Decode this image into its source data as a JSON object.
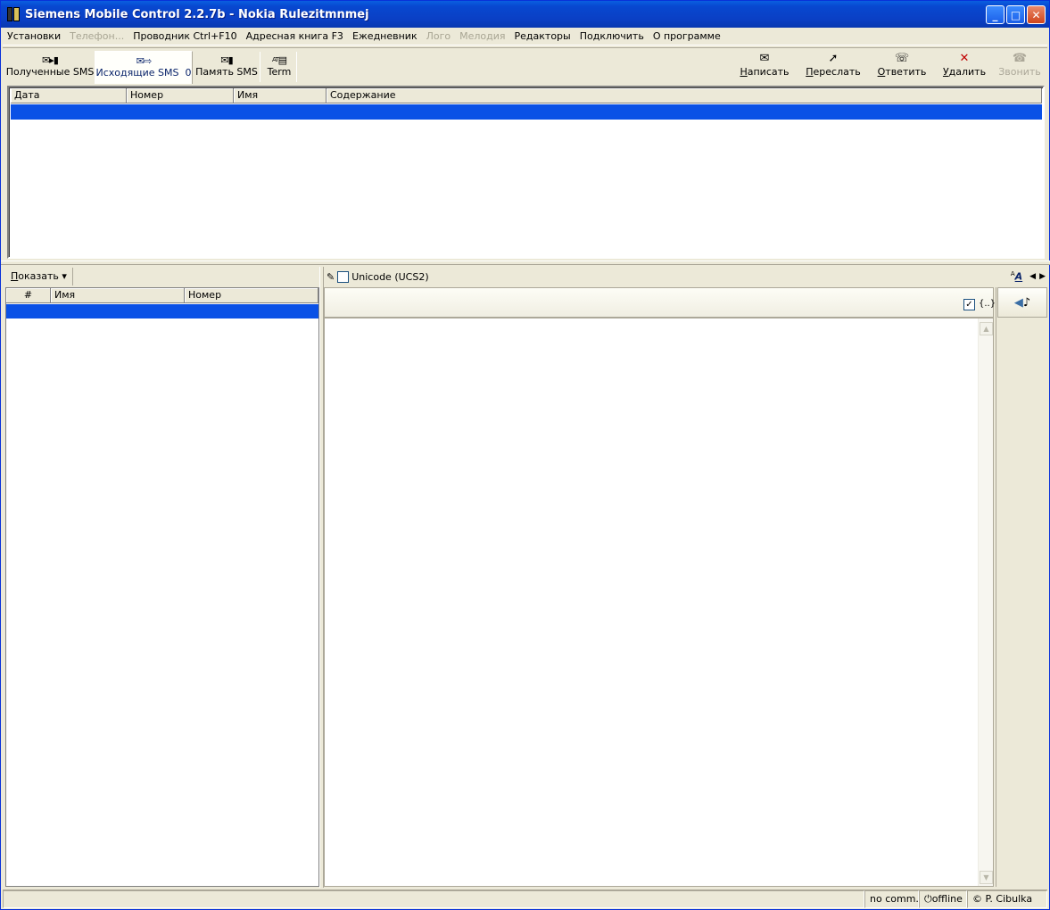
{
  "window": {
    "title": "Siemens Mobile Control 2.2.7b - Nokia Rulezitmnmej",
    "minimize_label": "_",
    "maximize_label": "□",
    "close_label": "✕"
  },
  "menu": [
    {
      "label": "Установки",
      "enabled": true
    },
    {
      "label": "Телефон...",
      "enabled": false
    },
    {
      "label": "Проводник Ctrl+F10",
      "enabled": true
    },
    {
      "label": "Адресная книга F3",
      "enabled": true
    },
    {
      "label": "Ежедневник",
      "enabled": true
    },
    {
      "label": "Лого",
      "enabled": false
    },
    {
      "label": "Мелодия",
      "enabled": false
    },
    {
      "label": "Редакторы",
      "enabled": true
    },
    {
      "label": "Подключить",
      "enabled": true
    },
    {
      "label": "О программе",
      "enabled": true
    }
  ],
  "tabs": {
    "received": {
      "label": "Полученные SMS",
      "icon": "envelope-to-phone-icon"
    },
    "outgoing": {
      "label": "Исходящие SMS",
      "count": "0",
      "icon": "envelope-arrow-icon"
    },
    "memory": {
      "label": "Память SMS",
      "icon": "envelope-memory-icon"
    },
    "term": {
      "label": "Term",
      "icon_text": "AT",
      "icon": "terminal-icon"
    }
  },
  "actions": {
    "write": {
      "accel": "Н",
      "rest": "аписать",
      "icon": "envelope-icon"
    },
    "forward": {
      "accel": "П",
      "rest": "ереслать",
      "icon": "forward-icon"
    },
    "reply": {
      "accel": "О",
      "rest": "тветить",
      "icon": "reply-icon"
    },
    "delete": {
      "accel": "У",
      "rest": "далить",
      "icon": "delete-x-icon",
      "color": "#c00000"
    },
    "call": {
      "label": "Звонить",
      "icon": "phone-icon",
      "enabled": false
    }
  },
  "sms_table": {
    "columns": [
      "Дата",
      "Номер",
      "Имя",
      "Содержание"
    ],
    "selection_color": "#0a51e6"
  },
  "contacts": {
    "show_accel": "П",
    "show_rest": "оказать",
    "columns": [
      "#",
      "Имя",
      "Номер"
    ]
  },
  "editor": {
    "unicode_label": "Unicode (UCS2)",
    "unicode_checked": false,
    "braces_label": "{..}",
    "braces_checked": true,
    "font_label": "A",
    "font_sup": "A"
  },
  "status": {
    "comm": "no comm.",
    "connection": "offline",
    "author": "© P. Cibulka"
  }
}
